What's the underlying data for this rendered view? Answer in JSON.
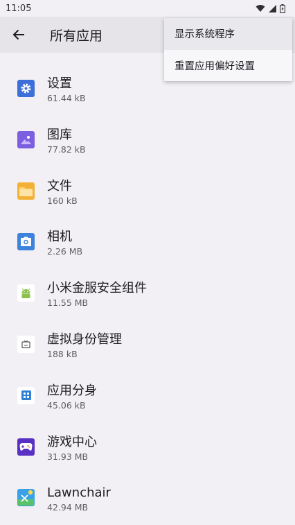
{
  "status_bar": {
    "time": "11:05"
  },
  "header": {
    "title": "所有应用"
  },
  "apps": [
    {
      "name": "设置",
      "size": "61.44 kB",
      "icon": "settings-icon",
      "color": "#3d6fd8"
    },
    {
      "name": "图库",
      "size": "77.82 kB",
      "icon": "gallery-icon",
      "color": "#7b5fe0"
    },
    {
      "name": "文件",
      "size": "160 kB",
      "icon": "folder-icon",
      "color": "#f2b134"
    },
    {
      "name": "相机",
      "size": "2.26 MB",
      "icon": "camera-icon",
      "color": "#3d82dc"
    },
    {
      "name": "小米金服安全组件",
      "size": "11.55 MB",
      "icon": "android-icon",
      "color": "#8bc34a"
    },
    {
      "name": "虚拟身份管理",
      "size": "188 kB",
      "icon": "tv-icon",
      "color": "#555555"
    },
    {
      "name": "应用分身",
      "size": "45.06 kB",
      "icon": "app-clone-icon",
      "color": "#2f7fd6"
    },
    {
      "name": "游戏中心",
      "size": "31.93 MB",
      "icon": "gamepad-icon",
      "color": "#5a2fc4"
    },
    {
      "name": "Lawnchair",
      "size": "42.94 MB",
      "icon": "lawnchair-icon",
      "color": "#3aa0e8"
    }
  ],
  "menu": {
    "items": [
      {
        "label": "显示系统程序"
      },
      {
        "label": "重置应用偏好设置"
      }
    ]
  }
}
